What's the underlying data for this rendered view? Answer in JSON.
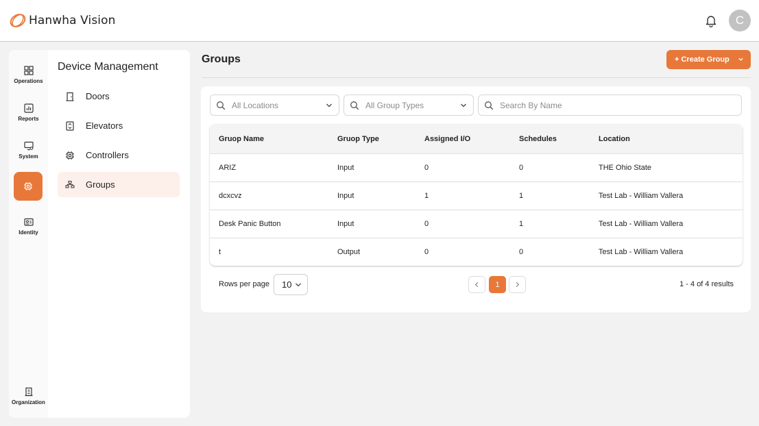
{
  "brand": {
    "name": "Hanwha Vision",
    "accent": "#e8783a"
  },
  "header": {
    "avatar_initial": "C"
  },
  "rail": {
    "items": [
      {
        "label": "Operations"
      },
      {
        "label": "Reports"
      },
      {
        "label": "System"
      },
      {
        "label": "Identity"
      },
      {
        "label": "Organization"
      }
    ]
  },
  "sidebar": {
    "title": "Device Management",
    "items": [
      {
        "label": "Doors"
      },
      {
        "label": "Elevators"
      },
      {
        "label": "Controllers"
      },
      {
        "label": "Groups"
      }
    ]
  },
  "page": {
    "title": "Groups",
    "create_label": "+ Create Group"
  },
  "filters": {
    "location_placeholder": "All Locations",
    "group_type_placeholder": "All Group Types",
    "search_placeholder": "Search By Name"
  },
  "table": {
    "columns": [
      "Gruop Name",
      "Gruop Type",
      "Assigned I/O",
      "Schedules",
      "Location"
    ],
    "rows": [
      [
        "ARIZ",
        "Input",
        "0",
        "0",
        "THE Ohio State"
      ],
      [
        "dcxcvz",
        "Input",
        "1",
        "1",
        "Test Lab - William Vallera"
      ],
      [
        "Desk Panic Button",
        "Input",
        "0",
        "1",
        "Test Lab - William Vallera"
      ],
      [
        "t",
        "Output",
        "0",
        "0",
        "Test Lab - William Vallera"
      ]
    ]
  },
  "pagination": {
    "rows_label": "Rows per page",
    "rows_value": "10",
    "current_page": "1",
    "results_text": "1 - 4 of 4 results"
  }
}
